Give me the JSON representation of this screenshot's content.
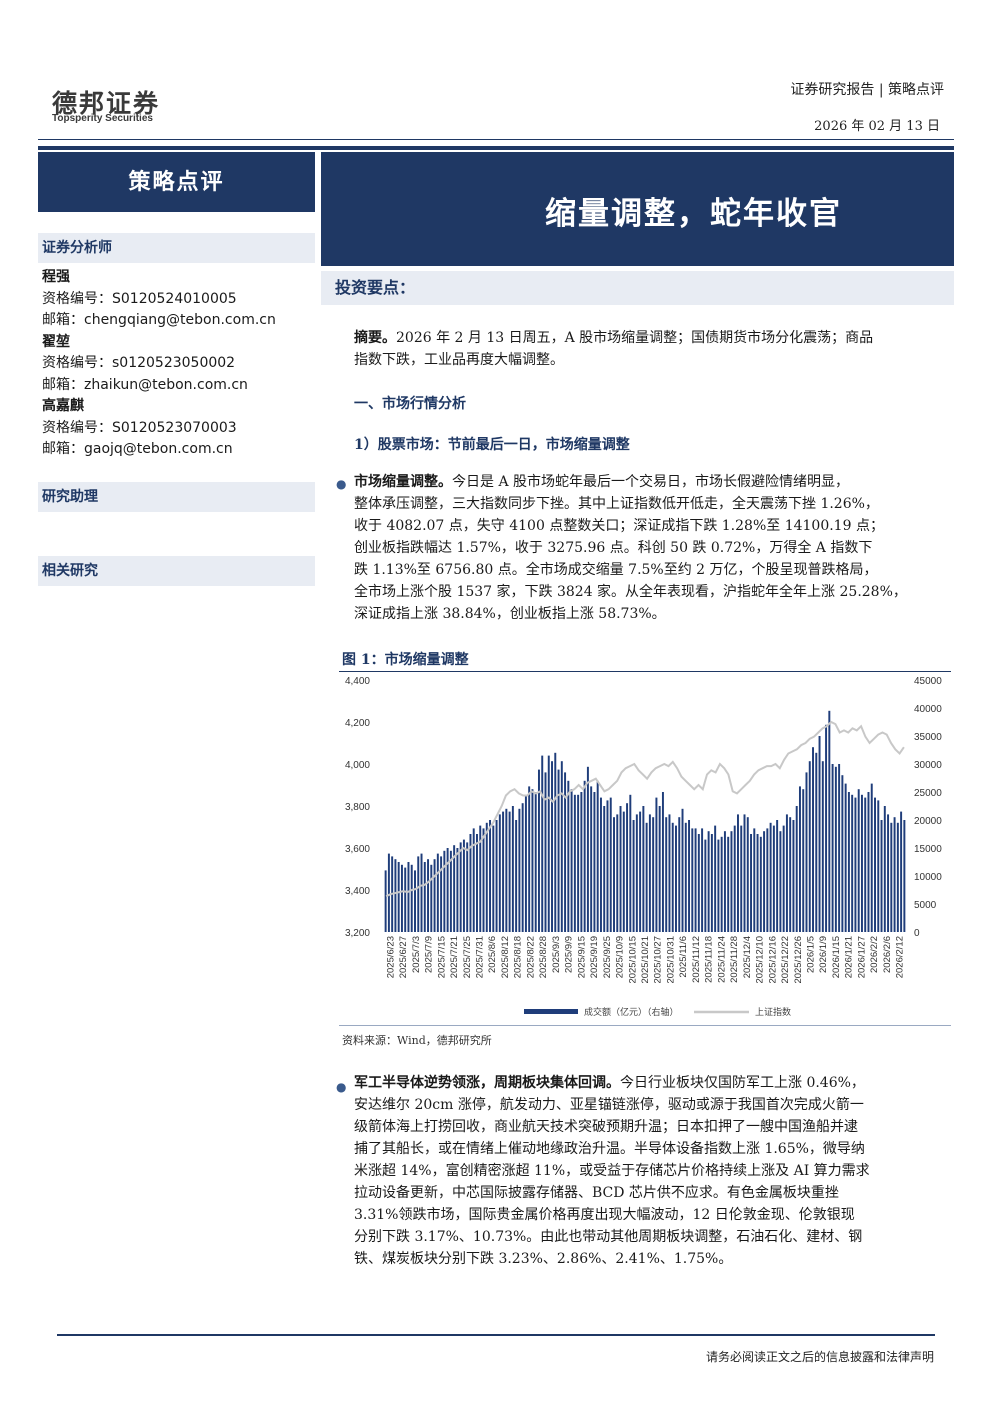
{
  "header": {
    "logo_cn": "德邦证券",
    "logo_en": "Topsperity Securities",
    "report_type": "证券研究报告 | 策略点评",
    "date": "2026 年 02 月 13 日"
  },
  "left_banner": "策略点评",
  "title": "缩量调整，蛇年收官",
  "sidebar": {
    "analysts_heading": "证券分析师",
    "analysts": [
      {
        "name": "程强",
        "cert": "资格编号：S0120524010005",
        "email": "邮箱：chengqiang@tebon.com.cn"
      },
      {
        "name": "翟堃",
        "cert": "资格编号：s0120523050002",
        "email": "邮箱：zhaikun@tebon.com.cn"
      },
      {
        "name": "高嘉麒",
        "cert": "资格编号：S0120523070003",
        "email": "邮箱：gaojq@tebon.com.cn"
      }
    ],
    "assistant_heading": "研究助理",
    "related_heading": "相关研究"
  },
  "main": {
    "invest_heading": "投资要点：",
    "summary_label": "摘要。",
    "summary_line1": "2026 年 2 月 13 日周五，A 股市场缩量调整；国债期货市场分化震荡；商品",
    "summary_line2": "指数下跌，工业品再度大幅调整。",
    "section1": "一、市场行情分析",
    "sub1": "1）股票市场：节前最后一日，市场缩量调整",
    "para1_label": "市场缩量调整。",
    "para1_lines": [
      "今日是 A 股市场蛇年最后一个交易日，市场长假避险情绪明显，",
      "整体承压调整，三大指数同步下挫。其中上证指数低开低走，全天震荡下挫 1.26%，",
      "收于 4082.07 点，失守 4100 点整数关口；深证成指下跌 1.28%至 14100.19 点；",
      "创业板指跌幅达 1.57%，收于 3275.96 点。科创 50 跌 0.72%，万得全 A 指数下",
      "跌 1.13%至 6756.80 点。全市场成交缩量 7.5%至约 2 万亿，个股呈现普跌格局，",
      "全市场上涨个股 1537 家，下跌 3824 家。从全年表现看，沪指蛇年全年上涨 25.28%，",
      "深证成指上涨 38.84%，创业板指上涨 58.73%。"
    ],
    "figure_title": "图 1：市场缩量调整",
    "source": "资料来源：Wind，德邦研究所",
    "para2_label": "军工半导体逆势领涨，周期板块集体回调。",
    "para2_lines": [
      "今日行业板块仅国防军工上涨 0.46%，",
      "安达维尔 20cm 涨停，航发动力、亚星锚链涨停，驱动或源于我国首次完成火箭一",
      "级箭体海上打捞回收，商业航天技术突破预期升温；日本扣押了一艘中国渔船并逮",
      "捕了其船长，或在情绪上催动地缘政治升温。半导体设备指数上涨 1.65%，微导纳",
      "米涨超 14%，富创精密涨超 11%，或受益于存储芯片价格持续上涨及 AI 算力需求",
      "拉动设备更新，中芯国际披露存储器、BCD 芯片供不应求。有色金属板块重挫",
      "3.31%领跌市场，国际贵金属价格再度出现大幅波动，12 日伦敦金现、伦敦银现",
      "分别下跌 3.17%、10.73%。由此也带动其他周期板块调整，石油石化、建材、钢",
      "铁、煤炭板块分别下跌 3.23%、2.86%、2.41%、1.75%。"
    ]
  },
  "footer": "请务必阅读正文之后的信息披露和法律声明",
  "colors": {
    "navy": "#1f3864",
    "bar": "#1f3d7a",
    "line": "#c8c8c8"
  },
  "chart_data": {
    "type": "bar",
    "title": "",
    "left_axis": {
      "ylim": [
        3200,
        4400
      ],
      "ticks": [
        "3,200",
        "3,400",
        "3,600",
        "3,800",
        "4,000",
        "4,200",
        "4,400"
      ]
    },
    "right_axis": {
      "ylim": [
        0,
        45000
      ],
      "ticks": [
        "0",
        "5000",
        "10000",
        "15000",
        "20000",
        "25000",
        "30000",
        "35000",
        "40000",
        "45000"
      ]
    },
    "x_tick_labels": [
      "2025/6/23",
      "2025/6/27",
      "2025/7/3",
      "2025/7/9",
      "2025/7/15",
      "2025/7/21",
      "2025/7/25",
      "2025/7/31",
      "2025/8/6",
      "2025/8/12",
      "2025/8/18",
      "2025/8/22",
      "2025/8/28",
      "2025/9/3",
      "2025/9/9",
      "2025/9/15",
      "2025/9/19",
      "2025/9/25",
      "2025/10/9",
      "2025/10/15",
      "2025/10/21",
      "2025/10/27",
      "2025/10/31",
      "2025/11/6",
      "2025/11/12",
      "2025/11/18",
      "2025/11/24",
      "2025/11/28",
      "2025/12/4",
      "2025/12/10",
      "2025/12/16",
      "2025/12/22",
      "2025/12/26",
      "2026/1/5",
      "2026/1/9",
      "2026/1/15",
      "2026/1/21",
      "2026/1/27",
      "2026/2/2",
      "2026/2/6",
      "2026/2/12"
    ],
    "series": [
      {
        "name": "成交额（亿元）（右轴）",
        "type": "bar",
        "axis": "right",
        "values": [
          11000,
          14000,
          13500,
          13000,
          12500,
          12000,
          11500,
          12500,
          12000,
          11000,
          13500,
          14000,
          12500,
          13000,
          12000,
          13000,
          14000,
          13500,
          14500,
          15000,
          14500,
          15500,
          15000,
          16000,
          16500,
          16000,
          17500,
          18500,
          17500,
          19000,
          18500,
          19500,
          20000,
          19000,
          20000,
          21000,
          21500,
          22000,
          21500,
          22500,
          20000,
          22000,
          23000,
          24500,
          26000,
          25500,
          25000,
          29000,
          31500,
          28500,
          31500,
          30500,
          32000,
          29000,
          30500,
          28500,
          27000,
          25500,
          24500,
          24500,
          25000,
          27000,
          29500,
          26000,
          25000,
          27000,
          24000,
          22500,
          23500,
          24000,
          20500,
          21000,
          22500,
          21500,
          23000,
          24500,
          20000,
          21000,
          21500,
          22500,
          19500,
          21000,
          20500,
          24000,
          22500,
          25000,
          20500,
          21000,
          19500,
          19000,
          20500,
          22000,
          19500,
          20000,
          18500,
          18500,
          17500,
          18500,
          16500,
          18000,
          17500,
          19000,
          16500,
          17000,
          18000,
          17000,
          18000,
          19000,
          21000,
          19000,
          21000,
          20500,
          17500,
          18500,
          17500,
          17000,
          18000,
          18500,
          19500,
          19000,
          20000,
          18000,
          19000,
          21000,
          20500,
          20000,
          22500,
          26000,
          25500,
          28500,
          30500,
          33000,
          32000,
          35000,
          30500,
          37000,
          39500,
          30000,
          29500,
          30000,
          28000,
          26500,
          25000,
          24500,
          24000,
          25500,
          24500,
          24000,
          25000,
          26500,
          24000,
          23500,
          20000,
          22500,
          21000,
          19500,
          20500,
          19500,
          21500,
          20000
        ]
      },
      {
        "name": "上证指数",
        "type": "line",
        "axis": "left",
        "values": [
          3370,
          3380,
          3385,
          3390,
          3395,
          3390,
          3400,
          3405,
          3420,
          3425,
          3440,
          3460,
          3480,
          3500,
          3520,
          3540,
          3560,
          3580,
          3600,
          3590,
          3610,
          3620,
          3630,
          3660,
          3690,
          3720,
          3760,
          3800,
          3850,
          3870,
          3880,
          3860,
          3850,
          3850,
          3870,
          3860,
          3870,
          3830,
          3840,
          3820,
          3850,
          3860,
          3840,
          3870,
          3880,
          3900,
          3880,
          3910,
          3920,
          3930,
          3900,
          3870,
          3880,
          3900,
          3920,
          3960,
          3980,
          3990,
          4000,
          3970,
          3950,
          3930,
          3960,
          3980,
          3990,
          4000,
          3990,
          4010,
          3980,
          3940,
          3920,
          3900,
          3880,
          3900,
          3880,
          3950,
          3970,
          3960,
          4000,
          3980,
          3950,
          3870,
          3860,
          3880,
          3900,
          3920,
          3950,
          3970,
          3980,
          3990,
          3990,
          4000,
          3980,
          4020,
          4050,
          4060,
          4070,
          4090,
          4100,
          4120,
          4130,
          4150,
          4170,
          4180,
          4200,
          4190,
          4150,
          4160,
          4150,
          4170,
          4160,
          4180,
          4130,
          4100,
          4120,
          4140,
          4150,
          4140,
          4100,
          4070,
          4050,
          4080
        ]
      }
    ],
    "legend": [
      "成交额（亿元）（右轴）",
      "上证指数"
    ]
  }
}
